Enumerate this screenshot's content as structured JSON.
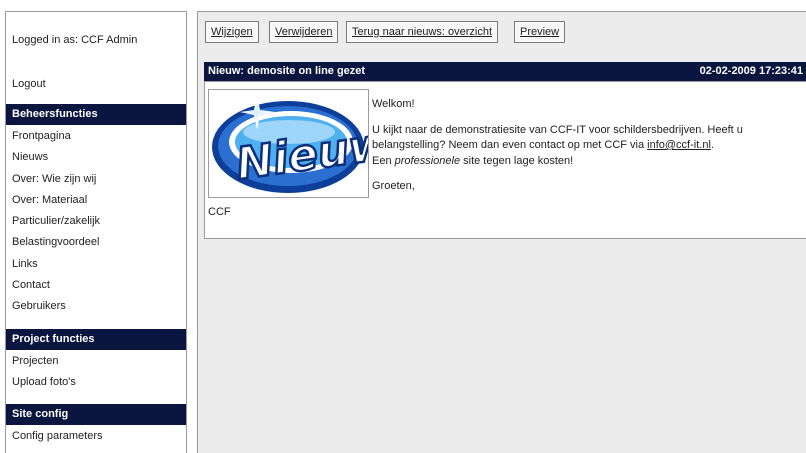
{
  "sidebar": {
    "logged_in": "Logged in as: CCF Admin",
    "logout": "Logout",
    "sections": [
      {
        "title": "Beheersfuncties",
        "items": [
          "Frontpagina",
          "Nieuws",
          "Over: Wie zijn wij",
          "Over: Materiaal",
          "Particulier/zakelijk",
          "Belastingvoordeel",
          "Links",
          "Contact",
          "Gebruikers"
        ]
      },
      {
        "title": "Project functies",
        "items": [
          "Projecten",
          "Upload foto's"
        ]
      },
      {
        "title": "Site config",
        "items": [
          "Config parameters"
        ]
      }
    ]
  },
  "toolbar": {
    "edit": "Wijzigen",
    "delete": "Verwijderen",
    "back": "Terug naar nieuws: overzicht",
    "preview": "Preview"
  },
  "news": {
    "title": "Nieuw: demosite on line gezet",
    "date": "02-02-2009 17:23:41",
    "logo_text": "Nieuw",
    "greeting": "Welkom!",
    "body_pre": "U kijkt naar de demonstratiesite van CCF-IT voor schildersbedrijven. Heeft u belangstelling? Neem dan even contact op met CCF via ",
    "email": "info@ccf-it.nl",
    "body_post": ".",
    "line3_pre": "Een ",
    "line3_em": "professionele",
    "line3_post": " site tegen lage kosten!",
    "closing": "Groeten,",
    "signature": "CCF"
  },
  "colors": {
    "header_bg": "#0a1640",
    "content_bg": "#ececec",
    "logo_blue": "#1b4fb0"
  }
}
